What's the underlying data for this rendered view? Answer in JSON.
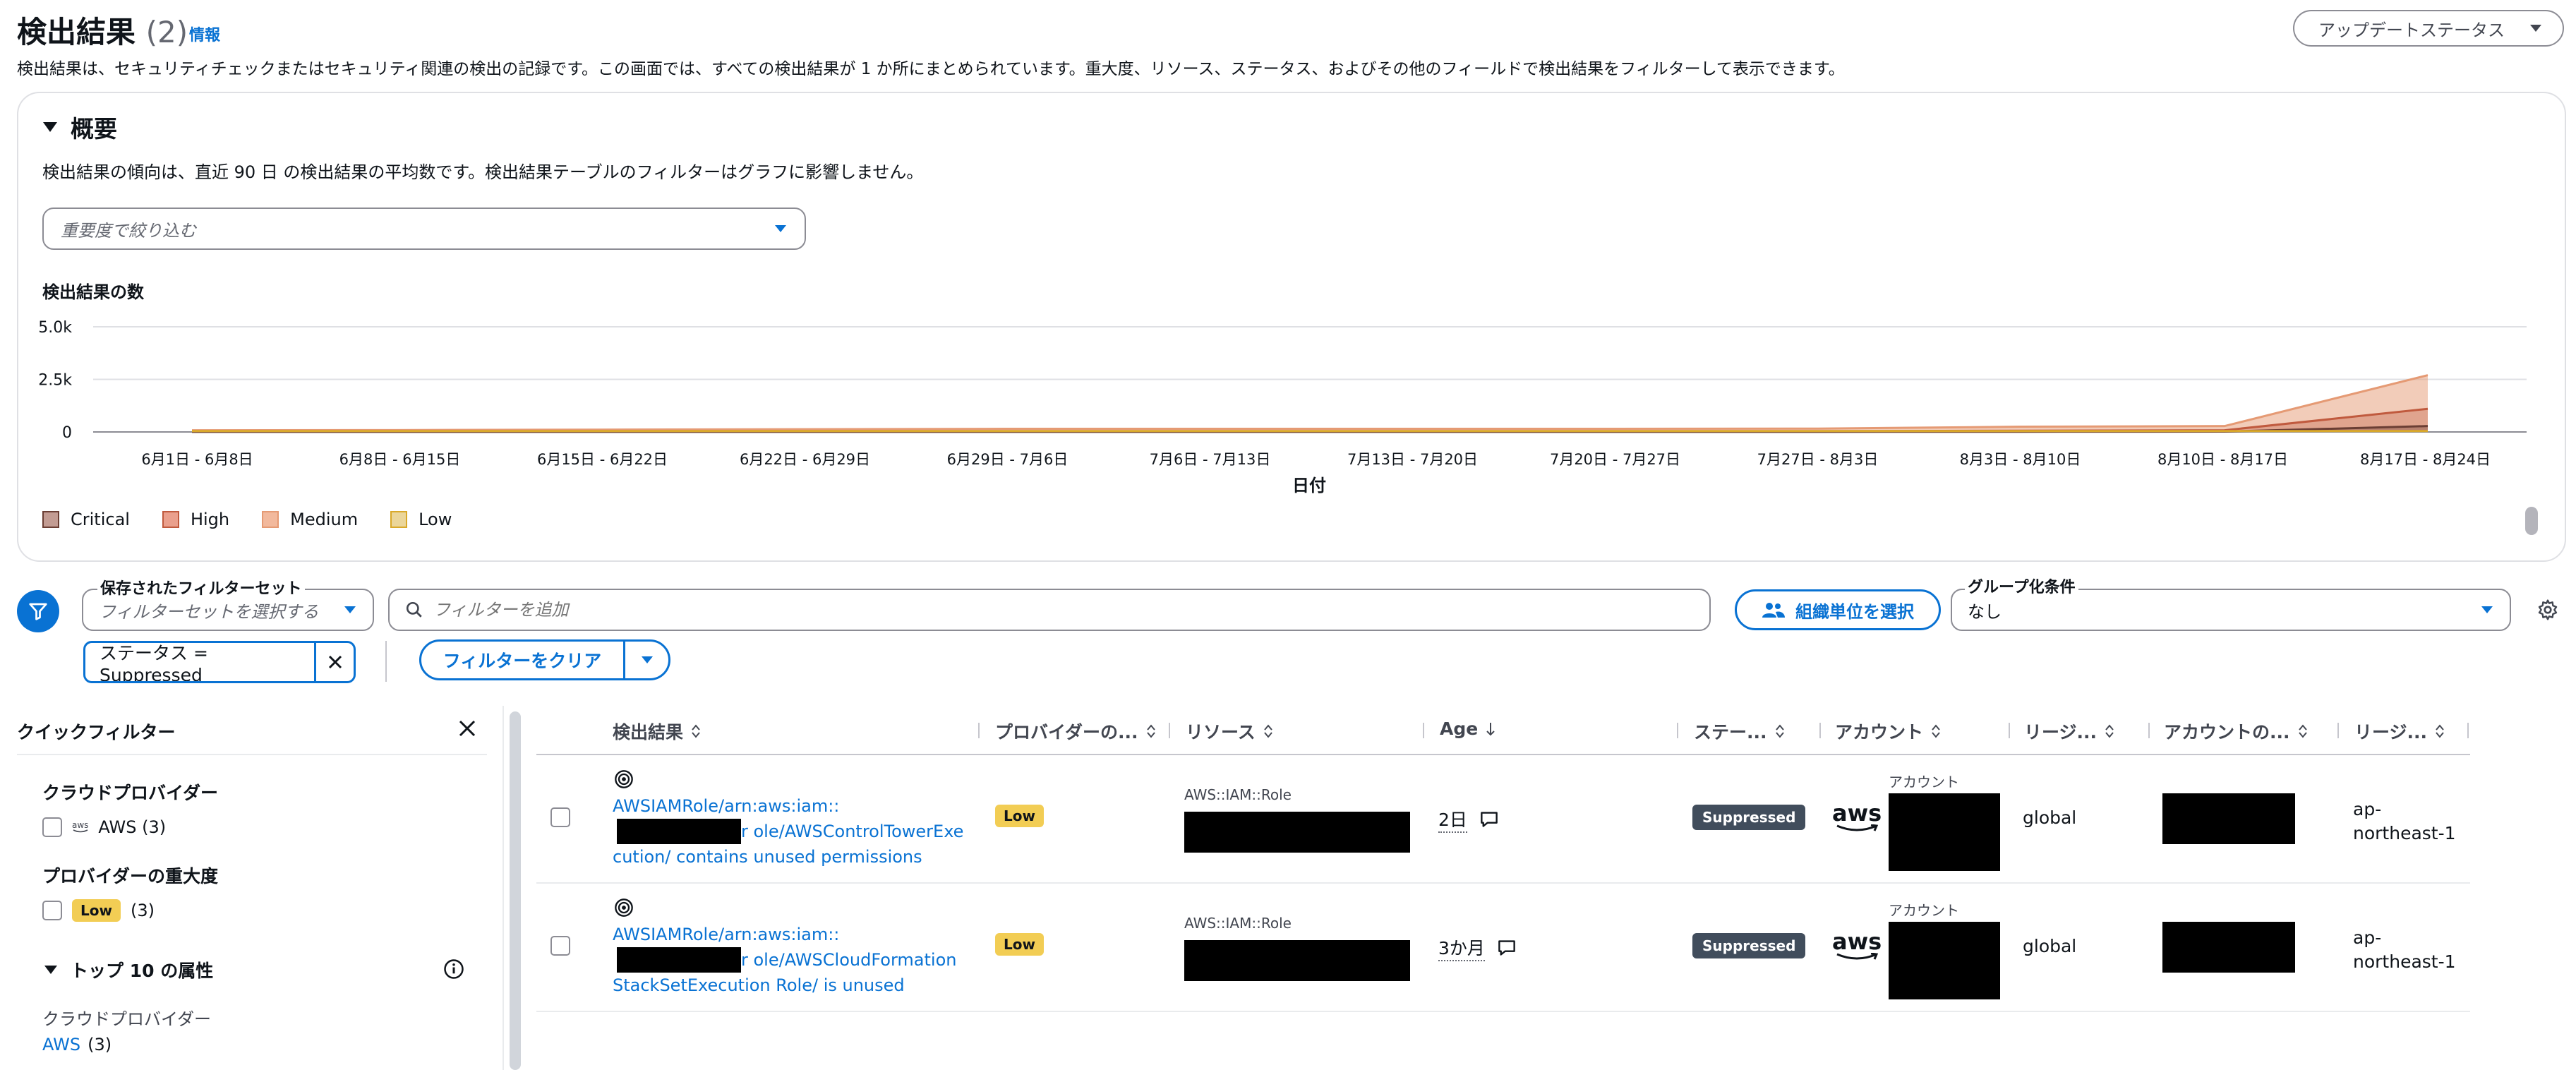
{
  "header": {
    "title": "検出結果",
    "count": "(2)",
    "info": "情報",
    "description": "検出結果は、セキュリティチェックまたはセキュリティ関連の検出の記録です。この画面では、すべての検出結果が 1 か所にまとめられています。重大度、リソース、ステータス、およびその他のフィールドで検出結果をフィルターして表示できます。",
    "update_button": "アップデートステータス"
  },
  "overview": {
    "title": "概要",
    "description": "検出結果の傾向は、直近 90 日 の検出結果の平均数です。検出結果テーブルのフィルターはグラフに影響しません。",
    "severity_placeholder": "重要度で絞り込む",
    "chart_heading": "検出結果の数"
  },
  "chart_data": {
    "type": "area",
    "title": "",
    "xlabel": "日付",
    "ylabel": "",
    "ylim": [
      0,
      5000
    ],
    "y_ticks": [
      "5.0k",
      "2.5k",
      "0"
    ],
    "categories": [
      "6月1日 - 6月8日",
      "6月8日 - 6月15日",
      "6月15日 - 6月22日",
      "6月22日 - 6月29日",
      "6月29日 - 7月6日",
      "7月6日 - 7月13日",
      "7月13日 - 7月20日",
      "7月20日 - 7月27日",
      "7月27日 - 8月3日",
      "8月3日 - 8月10日",
      "8月10日 - 8月17日",
      "8月17日 - 8月24日"
    ],
    "series": [
      {
        "name": "Medium",
        "color": "#e59a74",
        "values": [
          80,
          90,
          110,
          130,
          150,
          150,
          150,
          150,
          160,
          250,
          280,
          2700
        ]
      },
      {
        "name": "High",
        "color": "#c05a3e",
        "values": [
          20,
          20,
          25,
          30,
          30,
          30,
          30,
          30,
          35,
          60,
          80,
          1100
        ]
      },
      {
        "name": "Critical",
        "color": "#6b3e34",
        "values": [
          5,
          5,
          5,
          5,
          5,
          5,
          5,
          5,
          5,
          10,
          15,
          280
        ]
      },
      {
        "name": "Low",
        "color": "#d9a92a",
        "values": [
          40,
          40,
          40,
          40,
          40,
          40,
          40,
          40,
          40,
          40,
          40,
          40
        ]
      }
    ],
    "legend": [
      {
        "name": "Critical",
        "fill": "#c39c93",
        "stroke": "#6b3e34"
      },
      {
        "name": "High",
        "fill": "#eaa08d",
        "stroke": "#c05a3e"
      },
      {
        "name": "Medium",
        "fill": "#f2b99d",
        "stroke": "#e59a74"
      },
      {
        "name": "Low",
        "fill": "#ebd69a",
        "stroke": "#d9a92a"
      }
    ]
  },
  "filters": {
    "saved_label": "保存されたフィルターセット",
    "saved_placeholder": "フィルターセットを選択する",
    "search_placeholder": "フィルターを追加",
    "org_button": "組織単位を選択",
    "group_label": "グループ化条件",
    "group_value": "なし",
    "token": "ステータス = Suppressed",
    "clear_button": "フィルターをクリア"
  },
  "quick_filters": {
    "title": "クイックフィルター",
    "provider_heading": "クラウドプロバイダー",
    "provider_option": "AWS (3)",
    "provider_icon_text": "aws",
    "severity_heading": "プロバイダーの重大度",
    "severity_option": "Low",
    "severity_count": "(3)",
    "top10_heading": "トップ 10 の属性",
    "attr_label": "クラウドプロバイダー",
    "attr_value": "AWS",
    "attr_count": "(3)"
  },
  "table": {
    "columns": [
      "検出結果",
      "プロバイダーの...",
      "リソース",
      "Age",
      "ステー...",
      "アカウント",
      "リージ...",
      "アカウントの...",
      "リージ..."
    ],
    "account_label": "アカウント",
    "rows": [
      {
        "finding_prefix": "AWSIAMRole/arn:aws:iam::",
        "finding_suffix": "r ole/AWSControlTowerExecution/ contains unused permissions",
        "severity": "Low",
        "resource_type": "AWS::IAM::Role",
        "age": "2日",
        "status": "Suppressed",
        "account_logo": "aws",
        "region": "global",
        "account_region": "ap-northeast-1"
      },
      {
        "finding_prefix": "AWSIAMRole/arn:aws:iam::",
        "finding_suffix": "r ole/AWSCloudFormationStackSetExecution Role/ is unused",
        "severity": "Low",
        "resource_type": "AWS::IAM::Role",
        "age": "3か月",
        "status": "Suppressed",
        "account_logo": "aws",
        "region": "global",
        "account_region": "ap-northeast-1"
      }
    ]
  },
  "colors": {
    "accent": "#0972d3",
    "low_badge": "#f2cd54",
    "suppressed_badge": "#414d5c"
  }
}
